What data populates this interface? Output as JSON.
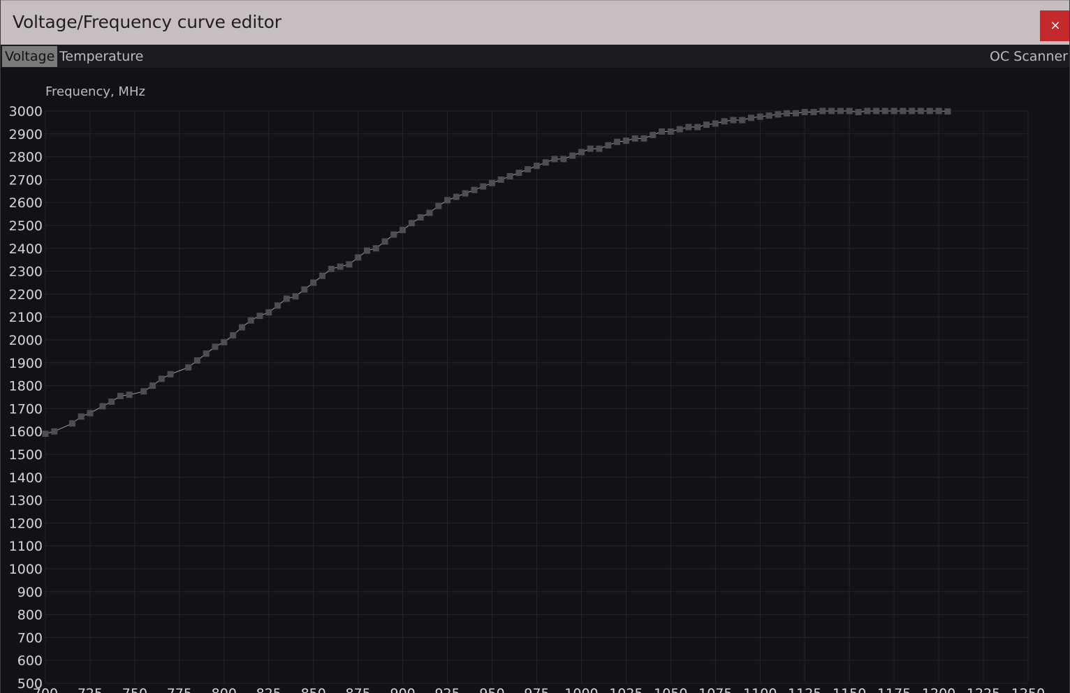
{
  "window": {
    "title": "Voltage/Frequency curve editor",
    "close_label": "×"
  },
  "tabs": [
    {
      "label": "Voltage",
      "active": true
    },
    {
      "label": "Temperature",
      "active": false
    },
    {
      "label": "OC Scanner",
      "active": false
    }
  ],
  "colors": {
    "title_bg": "#c7bfbf",
    "close_bg": "#c4292c",
    "plot_bg": "#121216",
    "grid": "#24242a",
    "point": "#4e4e52",
    "line": "#a0a0a0",
    "tick_text": "#d6d6d6"
  },
  "chart_data": {
    "type": "line",
    "ylabel": "Frequency, MHz",
    "xlabel": "",
    "xlim": [
      700,
      1250
    ],
    "ylim": [
      500,
      3000
    ],
    "xticks": [
      700,
      725,
      750,
      775,
      800,
      825,
      850,
      875,
      900,
      925,
      950,
      975,
      1000,
      1025,
      1050,
      1075,
      1100,
      1125,
      1150,
      1175,
      1200,
      1225,
      1250
    ],
    "yticks": [
      500,
      600,
      700,
      800,
      900,
      1000,
      1100,
      1200,
      1300,
      1400,
      1500,
      1600,
      1700,
      1800,
      1900,
      2000,
      2100,
      2200,
      2300,
      2400,
      2500,
      2600,
      2700,
      2800,
      2900,
      3000
    ],
    "grid": true,
    "series": [
      {
        "x": [
          700,
          705,
          715,
          720,
          725,
          732,
          737,
          742,
          747,
          755,
          760,
          765,
          770,
          780,
          785,
          790,
          795,
          800,
          805,
          810,
          815,
          820,
          825,
          830,
          835,
          840,
          845,
          850,
          855,
          860,
          865,
          870,
          875,
          880,
          885,
          890,
          895,
          900,
          905,
          910,
          915,
          920,
          925,
          930,
          935,
          940,
          945,
          950,
          955,
          960,
          965,
          970,
          975,
          980,
          985,
          990,
          995,
          1000,
          1005,
          1010,
          1015,
          1020,
          1025,
          1030,
          1035,
          1040,
          1045,
          1050,
          1055,
          1060,
          1065,
          1070,
          1075,
          1080,
          1085,
          1090,
          1095,
          1100,
          1105,
          1110,
          1115,
          1120,
          1125,
          1130,
          1135,
          1140,
          1145,
          1150,
          1155,
          1160,
          1165,
          1170,
          1175,
          1180,
          1185,
          1190,
          1195,
          1200,
          1205
        ],
        "y": [
          1590,
          1600,
          1635,
          1665,
          1680,
          1710,
          1730,
          1755,
          1760,
          1775,
          1800,
          1830,
          1850,
          1880,
          1910,
          1940,
          1970,
          1990,
          2020,
          2055,
          2085,
          2105,
          2120,
          2150,
          2180,
          2190,
          2220,
          2250,
          2280,
          2310,
          2320,
          2330,
          2360,
          2390,
          2400,
          2430,
          2460,
          2480,
          2510,
          2535,
          2555,
          2585,
          2610,
          2625,
          2640,
          2655,
          2670,
          2685,
          2700,
          2715,
          2730,
          2745,
          2760,
          2775,
          2790,
          2790,
          2805,
          2820,
          2835,
          2835,
          2850,
          2865,
          2870,
          2880,
          2880,
          2895,
          2910,
          2910,
          2920,
          2930,
          2930,
          2940,
          2945,
          2955,
          2960,
          2960,
          2970,
          2975,
          2980,
          2985,
          2990,
          2990,
          2995,
          2995,
          3000,
          3000,
          3000,
          3000,
          2995,
          3000,
          3000,
          3000,
          3000,
          3000,
          3000,
          3000,
          3000,
          3000,
          2998
        ]
      }
    ]
  }
}
